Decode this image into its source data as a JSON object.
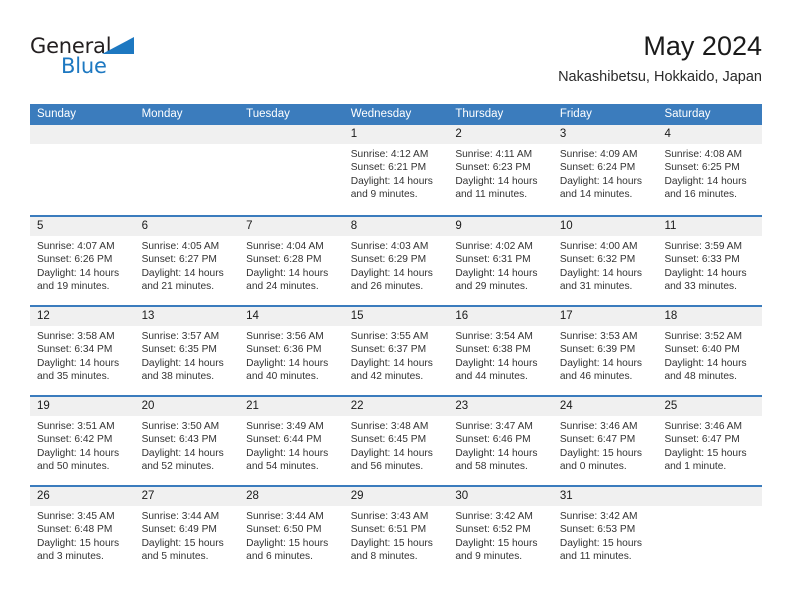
{
  "brand": {
    "name_part1": "General",
    "name_part2": "Blue",
    "flag_icon": "triangle-flag-icon",
    "accent_color": "#1d78c1"
  },
  "header": {
    "title": "May 2024",
    "subtitle": "Nakashibetsu, Hokkaido, Japan"
  },
  "colors": {
    "header_bar": "#3b7cbd",
    "day_header_bg": "#f0f0f0",
    "row_divider": "#3b7cbd"
  },
  "weekdays": [
    "Sunday",
    "Monday",
    "Tuesday",
    "Wednesday",
    "Thursday",
    "Friday",
    "Saturday"
  ],
  "weeks": [
    [
      {
        "day": "",
        "lines": []
      },
      {
        "day": "",
        "lines": []
      },
      {
        "day": "",
        "lines": []
      },
      {
        "day": "1",
        "lines": [
          "Sunrise: 4:12 AM",
          "Sunset: 6:21 PM",
          "Daylight: 14 hours",
          "and 9 minutes."
        ]
      },
      {
        "day": "2",
        "lines": [
          "Sunrise: 4:11 AM",
          "Sunset: 6:23 PM",
          "Daylight: 14 hours",
          "and 11 minutes."
        ]
      },
      {
        "day": "3",
        "lines": [
          "Sunrise: 4:09 AM",
          "Sunset: 6:24 PM",
          "Daylight: 14 hours",
          "and 14 minutes."
        ]
      },
      {
        "day": "4",
        "lines": [
          "Sunrise: 4:08 AM",
          "Sunset: 6:25 PM",
          "Daylight: 14 hours",
          "and 16 minutes."
        ]
      }
    ],
    [
      {
        "day": "5",
        "lines": [
          "Sunrise: 4:07 AM",
          "Sunset: 6:26 PM",
          "Daylight: 14 hours",
          "and 19 minutes."
        ]
      },
      {
        "day": "6",
        "lines": [
          "Sunrise: 4:05 AM",
          "Sunset: 6:27 PM",
          "Daylight: 14 hours",
          "and 21 minutes."
        ]
      },
      {
        "day": "7",
        "lines": [
          "Sunrise: 4:04 AM",
          "Sunset: 6:28 PM",
          "Daylight: 14 hours",
          "and 24 minutes."
        ]
      },
      {
        "day": "8",
        "lines": [
          "Sunrise: 4:03 AM",
          "Sunset: 6:29 PM",
          "Daylight: 14 hours",
          "and 26 minutes."
        ]
      },
      {
        "day": "9",
        "lines": [
          "Sunrise: 4:02 AM",
          "Sunset: 6:31 PM",
          "Daylight: 14 hours",
          "and 29 minutes."
        ]
      },
      {
        "day": "10",
        "lines": [
          "Sunrise: 4:00 AM",
          "Sunset: 6:32 PM",
          "Daylight: 14 hours",
          "and 31 minutes."
        ]
      },
      {
        "day": "11",
        "lines": [
          "Sunrise: 3:59 AM",
          "Sunset: 6:33 PM",
          "Daylight: 14 hours",
          "and 33 minutes."
        ]
      }
    ],
    [
      {
        "day": "12",
        "lines": [
          "Sunrise: 3:58 AM",
          "Sunset: 6:34 PM",
          "Daylight: 14 hours",
          "and 35 minutes."
        ]
      },
      {
        "day": "13",
        "lines": [
          "Sunrise: 3:57 AM",
          "Sunset: 6:35 PM",
          "Daylight: 14 hours",
          "and 38 minutes."
        ]
      },
      {
        "day": "14",
        "lines": [
          "Sunrise: 3:56 AM",
          "Sunset: 6:36 PM",
          "Daylight: 14 hours",
          "and 40 minutes."
        ]
      },
      {
        "day": "15",
        "lines": [
          "Sunrise: 3:55 AM",
          "Sunset: 6:37 PM",
          "Daylight: 14 hours",
          "and 42 minutes."
        ]
      },
      {
        "day": "16",
        "lines": [
          "Sunrise: 3:54 AM",
          "Sunset: 6:38 PM",
          "Daylight: 14 hours",
          "and 44 minutes."
        ]
      },
      {
        "day": "17",
        "lines": [
          "Sunrise: 3:53 AM",
          "Sunset: 6:39 PM",
          "Daylight: 14 hours",
          "and 46 minutes."
        ]
      },
      {
        "day": "18",
        "lines": [
          "Sunrise: 3:52 AM",
          "Sunset: 6:40 PM",
          "Daylight: 14 hours",
          "and 48 minutes."
        ]
      }
    ],
    [
      {
        "day": "19",
        "lines": [
          "Sunrise: 3:51 AM",
          "Sunset: 6:42 PM",
          "Daylight: 14 hours",
          "and 50 minutes."
        ]
      },
      {
        "day": "20",
        "lines": [
          "Sunrise: 3:50 AM",
          "Sunset: 6:43 PM",
          "Daylight: 14 hours",
          "and 52 minutes."
        ]
      },
      {
        "day": "21",
        "lines": [
          "Sunrise: 3:49 AM",
          "Sunset: 6:44 PM",
          "Daylight: 14 hours",
          "and 54 minutes."
        ]
      },
      {
        "day": "22",
        "lines": [
          "Sunrise: 3:48 AM",
          "Sunset: 6:45 PM",
          "Daylight: 14 hours",
          "and 56 minutes."
        ]
      },
      {
        "day": "23",
        "lines": [
          "Sunrise: 3:47 AM",
          "Sunset: 6:46 PM",
          "Daylight: 14 hours",
          "and 58 minutes."
        ]
      },
      {
        "day": "24",
        "lines": [
          "Sunrise: 3:46 AM",
          "Sunset: 6:47 PM",
          "Daylight: 15 hours",
          "and 0 minutes."
        ]
      },
      {
        "day": "25",
        "lines": [
          "Sunrise: 3:46 AM",
          "Sunset: 6:47 PM",
          "Daylight: 15 hours",
          "and 1 minute."
        ]
      }
    ],
    [
      {
        "day": "26",
        "lines": [
          "Sunrise: 3:45 AM",
          "Sunset: 6:48 PM",
          "Daylight: 15 hours",
          "and 3 minutes."
        ]
      },
      {
        "day": "27",
        "lines": [
          "Sunrise: 3:44 AM",
          "Sunset: 6:49 PM",
          "Daylight: 15 hours",
          "and 5 minutes."
        ]
      },
      {
        "day": "28",
        "lines": [
          "Sunrise: 3:44 AM",
          "Sunset: 6:50 PM",
          "Daylight: 15 hours",
          "and 6 minutes."
        ]
      },
      {
        "day": "29",
        "lines": [
          "Sunrise: 3:43 AM",
          "Sunset: 6:51 PM",
          "Daylight: 15 hours",
          "and 8 minutes."
        ]
      },
      {
        "day": "30",
        "lines": [
          "Sunrise: 3:42 AM",
          "Sunset: 6:52 PM",
          "Daylight: 15 hours",
          "and 9 minutes."
        ]
      },
      {
        "day": "31",
        "lines": [
          "Sunrise: 3:42 AM",
          "Sunset: 6:53 PM",
          "Daylight: 15 hours",
          "and 11 minutes."
        ]
      },
      {
        "day": "",
        "lines": []
      }
    ]
  ]
}
